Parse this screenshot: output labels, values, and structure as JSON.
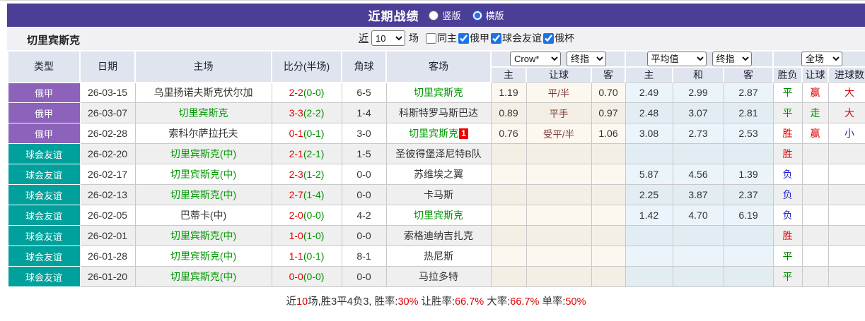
{
  "colors": {
    "red": "#e00000",
    "green": "#008800",
    "blue": "#2323cc",
    "black": "#333333",
    "team_green": "#009900",
    "type_purple": "#8c62ba",
    "type_teal": "#00a19c",
    "header_purple": "#4b3e96",
    "accent_blue": "#1a73e8",
    "handicap": "#7b3a3a"
  },
  "title_bar": {
    "title": "近期战绩",
    "radios": [
      "竖版",
      "横版"
    ],
    "selected": "横版"
  },
  "team_bar": {
    "team_name": "切里宾斯克",
    "near_label": "近",
    "match_count": "10",
    "games_label": "场",
    "filters": [
      {
        "label": "同主",
        "checked": false
      },
      {
        "label": "俄甲",
        "checked": true
      },
      {
        "label": "球会友谊",
        "checked": true
      },
      {
        "label": "俄杯",
        "checked": true
      }
    ]
  },
  "table": {
    "static_headers": [
      "类型",
      "日期",
      "主场",
      "比分(半场)",
      "角球",
      "客场"
    ],
    "group_selects": {
      "odds_source": "Crow*",
      "odds_time": "终指",
      "avg_source": "平均值",
      "avg_time": "终指",
      "scope": "全场"
    },
    "sub_headers": [
      "主",
      "让球",
      "客",
      "主",
      "和",
      "客",
      "胜负",
      "让球",
      "进球数"
    ],
    "rows": [
      {
        "type": "俄甲",
        "type_color": "type_purple",
        "date": "26-03-15",
        "home": {
          "text": "乌里扬诺夫斯克伏尔加",
          "green": false
        },
        "score": {
          "full": "2-2",
          "half": "(0-0)"
        },
        "corner": "6-5",
        "away": {
          "text": "切里宾斯克",
          "green": true,
          "red_card": ""
        },
        "odds_home": "1.19",
        "odds_handicap": "平/半",
        "odds_away": "0.70",
        "avg_home": "2.49",
        "avg_draw": "2.99",
        "avg_away": "2.87",
        "result": "平",
        "result_color": "green",
        "handicap_result": "赢",
        "handicap_result_color": "red",
        "goals": "大",
        "goals_color": "red"
      },
      {
        "type": "俄甲",
        "type_color": "type_purple",
        "date": "26-03-07",
        "home": {
          "text": "切里宾斯克",
          "green": true
        },
        "score": {
          "full": "3-3",
          "half": "(2-2)"
        },
        "corner": "1-4",
        "away": {
          "text": "科斯特罗马斯巴达",
          "green": false,
          "red_card": ""
        },
        "odds_home": "0.89",
        "odds_handicap": "平手",
        "odds_away": "0.97",
        "avg_home": "2.48",
        "avg_draw": "3.07",
        "avg_away": "2.81",
        "result": "平",
        "result_color": "green",
        "handicap_result": "走",
        "handicap_result_color": "green",
        "goals": "大",
        "goals_color": "red"
      },
      {
        "type": "俄甲",
        "type_color": "type_purple",
        "date": "26-02-28",
        "home": {
          "text": "索科尔萨拉托夫",
          "green": false
        },
        "score": {
          "full": "0-1",
          "half": "(0-1)"
        },
        "corner": "3-0",
        "away": {
          "text": "切里宾斯克",
          "green": true,
          "red_card": "1"
        },
        "odds_home": "0.76",
        "odds_handicap": "受平/半",
        "odds_away": "1.06",
        "avg_home": "3.08",
        "avg_draw": "2.73",
        "avg_away": "2.53",
        "result": "胜",
        "result_color": "red",
        "handicap_result": "赢",
        "handicap_result_color": "red",
        "goals": "小",
        "goals_color": "blue"
      },
      {
        "type": "球会友谊",
        "type_color": "type_teal",
        "date": "26-02-20",
        "home": {
          "text": "切里宾斯克(中)",
          "green": true
        },
        "score": {
          "full": "2-1",
          "half": "(2-1)"
        },
        "corner": "1-5",
        "away": {
          "text": "圣彼得堡泽尼特B队",
          "green": false,
          "red_card": ""
        },
        "odds_home": "",
        "odds_handicap": "",
        "odds_away": "",
        "avg_home": "",
        "avg_draw": "",
        "avg_away": "",
        "result": "胜",
        "result_color": "red",
        "handicap_result": "",
        "handicap_result_color": "black",
        "goals": "",
        "goals_color": "black"
      },
      {
        "type": "球会友谊",
        "type_color": "type_teal",
        "date": "26-02-17",
        "home": {
          "text": "切里宾斯克(中)",
          "green": true
        },
        "score": {
          "full": "2-3",
          "half": "(1-2)"
        },
        "corner": "0-0",
        "away": {
          "text": "苏维埃之翼",
          "green": false,
          "red_card": ""
        },
        "odds_home": "",
        "odds_handicap": "",
        "odds_away": "",
        "avg_home": "5.87",
        "avg_draw": "4.56",
        "avg_away": "1.39",
        "result": "负",
        "result_color": "blue",
        "handicap_result": "",
        "handicap_result_color": "black",
        "goals": "",
        "goals_color": "black"
      },
      {
        "type": "球会友谊",
        "type_color": "type_teal",
        "date": "26-02-13",
        "home": {
          "text": "切里宾斯克(中)",
          "green": true
        },
        "score": {
          "full": "2-7",
          "half": "(1-4)"
        },
        "corner": "0-0",
        "away": {
          "text": "卡马斯",
          "green": false,
          "red_card": ""
        },
        "odds_home": "",
        "odds_handicap": "",
        "odds_away": "",
        "avg_home": "2.25",
        "avg_draw": "3.87",
        "avg_away": "2.37",
        "result": "负",
        "result_color": "blue",
        "handicap_result": "",
        "handicap_result_color": "black",
        "goals": "",
        "goals_color": "black"
      },
      {
        "type": "球会友谊",
        "type_color": "type_teal",
        "date": "26-02-05",
        "home": {
          "text": "巴蒂卡(中)",
          "green": false
        },
        "score": {
          "full": "2-0",
          "half": "(0-0)"
        },
        "corner": "4-2",
        "away": {
          "text": "切里宾斯克",
          "green": true,
          "red_card": ""
        },
        "odds_home": "",
        "odds_handicap": "",
        "odds_away": "",
        "avg_home": "1.42",
        "avg_draw": "4.70",
        "avg_away": "6.19",
        "result": "负",
        "result_color": "blue",
        "handicap_result": "",
        "handicap_result_color": "black",
        "goals": "",
        "goals_color": "black"
      },
      {
        "type": "球会友谊",
        "type_color": "type_teal",
        "date": "26-02-01",
        "home": {
          "text": "切里宾斯克(中)",
          "green": true
        },
        "score": {
          "full": "1-0",
          "half": "(1-0)"
        },
        "corner": "0-0",
        "away": {
          "text": "索格迪纳吉扎克",
          "green": false,
          "red_card": ""
        },
        "odds_home": "",
        "odds_handicap": "",
        "odds_away": "",
        "avg_home": "",
        "avg_draw": "",
        "avg_away": "",
        "result": "胜",
        "result_color": "red",
        "handicap_result": "",
        "handicap_result_color": "black",
        "goals": "",
        "goals_color": "black"
      },
      {
        "type": "球会友谊",
        "type_color": "type_teal",
        "date": "26-01-28",
        "home": {
          "text": "切里宾斯克(中)",
          "green": true
        },
        "score": {
          "full": "1-1",
          "half": "(0-1)"
        },
        "corner": "8-1",
        "away": {
          "text": "热尼斯",
          "green": false,
          "red_card": ""
        },
        "odds_home": "",
        "odds_handicap": "",
        "odds_away": "",
        "avg_home": "",
        "avg_draw": "",
        "avg_away": "",
        "result": "平",
        "result_color": "green",
        "handicap_result": "",
        "handicap_result_color": "black",
        "goals": "",
        "goals_color": "black"
      },
      {
        "type": "球会友谊",
        "type_color": "type_teal",
        "date": "26-01-20",
        "home": {
          "text": "切里宾斯克(中)",
          "green": true
        },
        "score": {
          "full": "0-0",
          "half": "(0-0)"
        },
        "corner": "0-0",
        "away": {
          "text": "马拉多特",
          "green": false,
          "red_card": ""
        },
        "odds_home": "",
        "odds_handicap": "",
        "odds_away": "",
        "avg_home": "",
        "avg_draw": "",
        "avg_away": "",
        "result": "平",
        "result_color": "green",
        "handicap_result": "",
        "handicap_result_color": "black",
        "goals": "",
        "goals_color": "black"
      }
    ]
  },
  "footer": {
    "segments": [
      {
        "text": "近",
        "color": "black"
      },
      {
        "text": "10",
        "color": "red"
      },
      {
        "text": "场,胜3平4负3, 胜率:",
        "color": "black"
      },
      {
        "text": "30%",
        "color": "red"
      },
      {
        "text": " 让胜率:",
        "color": "black"
      },
      {
        "text": "66.7%",
        "color": "red"
      },
      {
        "text": " 大率:",
        "color": "black"
      },
      {
        "text": "66.7%",
        "color": "red"
      },
      {
        "text": " 单率:",
        "color": "black"
      },
      {
        "text": "50%",
        "color": "red"
      }
    ]
  }
}
